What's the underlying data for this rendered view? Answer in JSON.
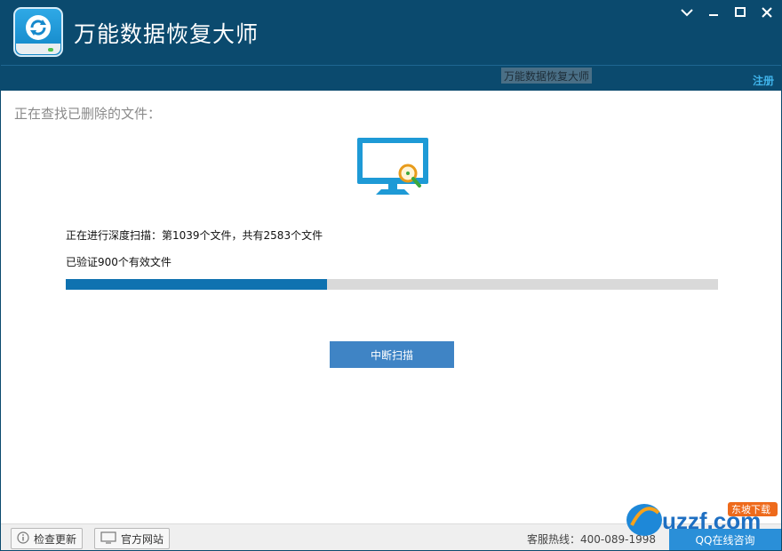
{
  "app": {
    "title": "万能数据恢复大师",
    "subbar_label": "万能数据恢复大师",
    "register_label": "注册"
  },
  "scan": {
    "heading": "正在查找已删除的文件：",
    "progress_text": "正在进行深度扫描：第1039个文件，共有2583个文件",
    "verified_text": "已验证900个有效文件",
    "progress_fraction": 0.4,
    "stop_label": "中断扫描"
  },
  "footer": {
    "check_update_label": "检查更新",
    "website_label": "官方网站",
    "hotline": "客服热线：400-089-1998",
    "qq_label": "QQ在线咨询"
  },
  "icons": {
    "logo": "refresh-disk-icon",
    "monitor": "monitor-search-icon",
    "minimize": "chevron-down-icon",
    "restore": "minus-icon",
    "maximize": "square-icon",
    "close": "close-icon",
    "info": "info-icon",
    "website": "monitor-icon"
  },
  "colors": {
    "titlebar": "#0b4a6e",
    "progress": "#0f72b0",
    "button": "#3f84c5",
    "accent": "#3fb3ea"
  },
  "watermark": {
    "brand": "uzzf.com",
    "tag": "东坡下载"
  }
}
